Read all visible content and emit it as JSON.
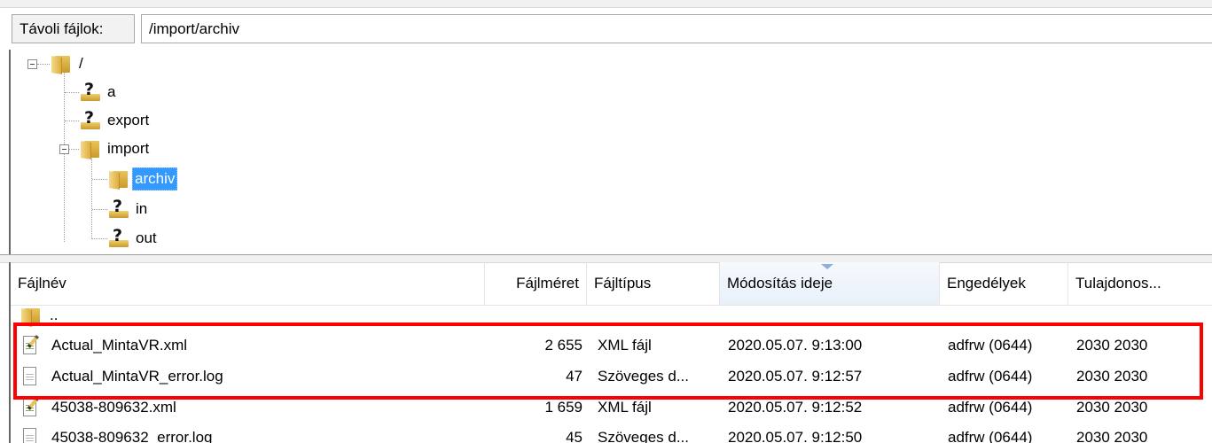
{
  "remote_path": {
    "label": "Távoli fájlok:",
    "value": "/import/archiv"
  },
  "tree": {
    "root": "/",
    "items": [
      {
        "label": "a",
        "icon": "unknown-folder-icon"
      },
      {
        "label": "export",
        "icon": "unknown-folder-icon"
      },
      {
        "label": "import",
        "icon": "folder-icon"
      },
      {
        "label": "archiv",
        "icon": "folder-icon",
        "selected": true
      },
      {
        "label": "in",
        "icon": "unknown-folder-icon"
      },
      {
        "label": "out",
        "icon": "unknown-folder-icon"
      }
    ]
  },
  "file_list": {
    "columns": [
      "Fájlnév",
      "Fájlméret",
      "Fájltípus",
      "Módosítás ideje",
      "Engedélyek",
      "Tulajdonos..."
    ],
    "sorted_column": "Módosítás ideje",
    "parent_dir": "..",
    "rows": [
      {
        "name": "Actual_MintaVR.xml",
        "size": "2 655",
        "type": "XML fájl",
        "modified": "2020.05.07. 9:13:00",
        "perms": "adfrw (0644)",
        "owner": "2030 2030",
        "icon": "xml-file-icon"
      },
      {
        "name": "Actual_MintaVR_error.log",
        "size": "47",
        "type": "Szöveges d...",
        "modified": "2020.05.07. 9:12:57",
        "perms": "adfrw (0644)",
        "owner": "2030 2030",
        "icon": "text-file-icon"
      },
      {
        "name": "45038-809632.xml",
        "size": "1 659",
        "type": "XML fájl",
        "modified": "2020.05.07. 9:12:52",
        "perms": "adfrw (0644)",
        "owner": "2030 2030",
        "icon": "xml-file-icon"
      },
      {
        "name": "45038-809632_error.log",
        "size": "45",
        "type": "Szöveges d...",
        "modified": "2020.05.07. 9:12:50",
        "perms": "adfrw (0644)",
        "owner": "2030 2030",
        "icon": "text-file-icon"
      }
    ]
  },
  "colors": {
    "selection": "#3399ff",
    "annotation": "#ff0000"
  }
}
